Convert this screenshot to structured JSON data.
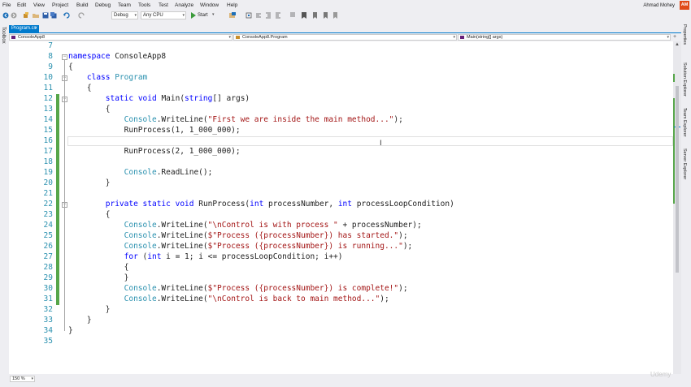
{
  "menu": [
    "File",
    "Edit",
    "View",
    "Project",
    "Build",
    "Debug",
    "Team",
    "Tools",
    "Test",
    "Analyze",
    "Window",
    "Help"
  ],
  "user": {
    "name": "Ahmad Mohey",
    "initials": "AM"
  },
  "toolbar": {
    "config": "Debug",
    "platform": "Any CPU",
    "start_label": "Start"
  },
  "toolbox_label": "Toolbox",
  "right_tabs": [
    "Properties",
    "Solution Explorer",
    "Team Explorer",
    "Server Explorer"
  ],
  "tab": {
    "name": "Program.cs",
    "close": "×"
  },
  "nav": {
    "project": "ConsoleApp8",
    "type": "ConsoleApp8.Program",
    "member": "Main(string[] args)"
  },
  "editor": {
    "lines": [
      {
        "n": "7",
        "code": ""
      },
      {
        "n": "8",
        "code": "namespace ConsoleApp8"
      },
      {
        "n": "9",
        "code": "{"
      },
      {
        "n": "10",
        "code": "    class Program"
      },
      {
        "n": "11",
        "code": "    {"
      },
      {
        "n": "12",
        "code": "        static void Main(string[] args)"
      },
      {
        "n": "13",
        "code": "        {"
      },
      {
        "n": "14",
        "code": "            Console.WriteLine(\"First we are inside the main method...\");"
      },
      {
        "n": "15",
        "code": "            RunProcess(1, 1_000_000);"
      },
      {
        "n": "16",
        "code": ""
      },
      {
        "n": "17",
        "code": "            RunProcess(2, 1_000_000);"
      },
      {
        "n": "18",
        "code": ""
      },
      {
        "n": "19",
        "code": "            Console.ReadLine();"
      },
      {
        "n": "20",
        "code": "        }"
      },
      {
        "n": "21",
        "code": ""
      },
      {
        "n": "22",
        "code": "        private static void RunProcess(int processNumber, int processLoopCondition)"
      },
      {
        "n": "23",
        "code": "        {"
      },
      {
        "n": "24",
        "code": "            Console.WriteLine(\"\\nControl is with process \" + processNumber);"
      },
      {
        "n": "25",
        "code": "            Console.WriteLine($\"Process ({processNumber}) has started.\");"
      },
      {
        "n": "26",
        "code": "            Console.WriteLine($\"Process ({processNumber}) is running...\");"
      },
      {
        "n": "27",
        "code": "            for (int i = 1; i <= processLoopCondition; i++)"
      },
      {
        "n": "28",
        "code": "            {"
      },
      {
        "n": "29",
        "code": "            }"
      },
      {
        "n": "30",
        "code": "            Console.WriteLine($\"Process ({processNumber}) is complete!\");"
      },
      {
        "n": "31",
        "code": "            Console.WriteLine(\"\\nControl is back to main method...\");"
      },
      {
        "n": "32",
        "code": "        }"
      },
      {
        "n": "33",
        "code": "    }"
      },
      {
        "n": "34",
        "code": "}"
      },
      {
        "n": "35",
        "code": ""
      }
    ]
  },
  "zoom": "150 %",
  "watermark": "Udemy",
  "colors": {
    "keyword": "#0000ff",
    "type": "#2b91af",
    "string": "#a31515",
    "accent": "#007acc",
    "change": "#57a64a",
    "line_number": "#2b91af"
  }
}
